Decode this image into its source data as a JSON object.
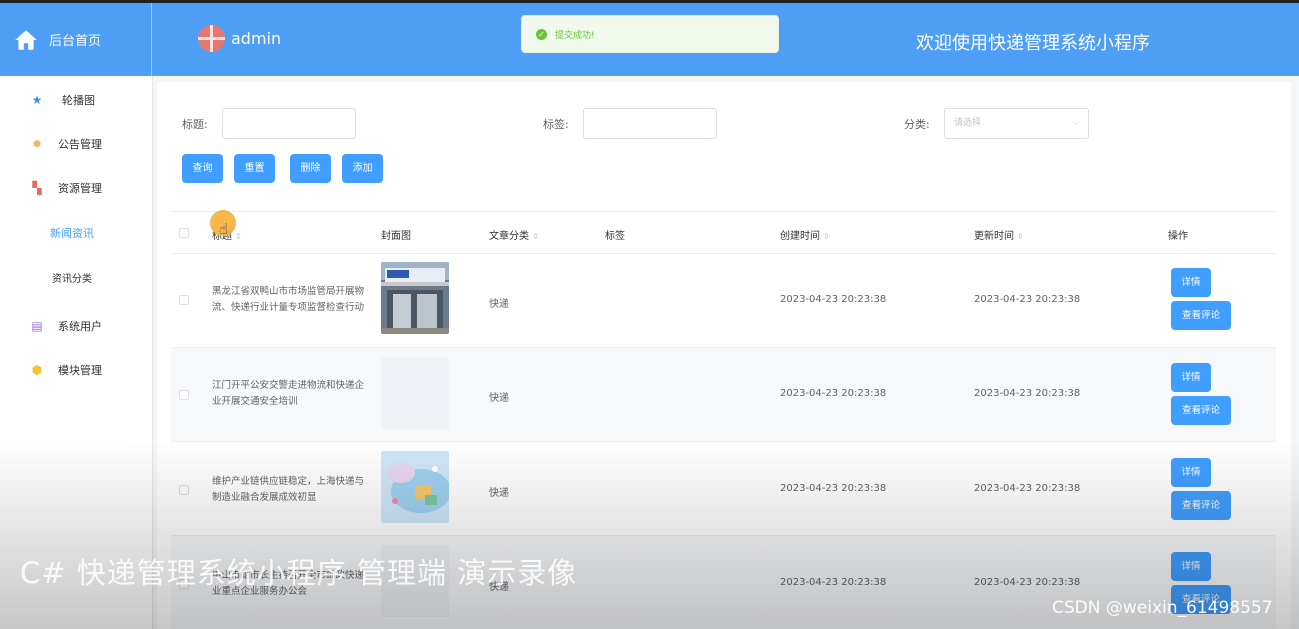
{
  "header": {
    "brand": "后台首页",
    "user": "admin",
    "welcome": "欢迎使用快递管理系统小程序",
    "toast": "提交成功!"
  },
  "sidebar": {
    "items": [
      {
        "label": "轮播图",
        "icon": "star-icon",
        "color": "#3a8ee6"
      },
      {
        "label": "公告管理",
        "icon": "gear-icon",
        "color": "#f0b35a"
      },
      {
        "label": "资源管理",
        "icon": "grid-icon",
        "color": "#e86a5c"
      },
      {
        "label": "新闻资讯",
        "active": true
      },
      {
        "label": "资讯分类"
      },
      {
        "label": "系统用户",
        "icon": "archive-icon",
        "color": "#9a6ed0"
      },
      {
        "label": "模块管理",
        "icon": "cube-icon",
        "color": "#f2c230"
      }
    ]
  },
  "filters": {
    "title_label": "标题:",
    "tag_label": "标签:",
    "category_label": "分类:",
    "category_placeholder": "请选择"
  },
  "actions": {
    "query": "查询",
    "reset": "重置",
    "delete": "删除",
    "add": "添加"
  },
  "table": {
    "columns": {
      "title": "标题",
      "cover": "封面图",
      "category": "文章分类",
      "tags": "标签",
      "created": "创建时间",
      "updated": "更新时间",
      "ops": "操作"
    },
    "rows": [
      {
        "title": "黑龙江省双鸭山市市场监管局开展物流、快递行业计量专项监督检查行动",
        "category": "快递",
        "created": "2023-04-23 20:23:38",
        "updated": "2023-04-23 20:23:38",
        "detail": "详情",
        "comments": "查看评论"
      },
      {
        "title": "江门开平公安交警走进物流和快递企业开展交通安全培训",
        "category": "快递",
        "created": "2023-04-23 20:23:38",
        "updated": "2023-04-23 20:23:38",
        "detail": "详情",
        "comments": "查看评论"
      },
      {
        "title": "维护产业链供应链稳定，上海快递与制造业融合发展成效初显",
        "category": "快递",
        "created": "2023-04-23 20:23:38",
        "updated": "2023-04-23 20:23:38",
        "detail": "详情",
        "comments": "查看评论"
      },
      {
        "title": "中山市副市长主持召开全市邮政快递业重点企业服务办公会",
        "category": "快递",
        "created": "2023-04-23 20:23:38",
        "updated": "2023-04-23 20:23:38",
        "detail": "详情",
        "comments": "查看评论"
      }
    ]
  },
  "overlay": {
    "caption": "C# 快递管理系统小程序 管理端 演示录像",
    "watermark": "CSDN @weixin_61498557"
  },
  "colors": {
    "header": "#4f9ef5",
    "primary": "#409eff",
    "success": "#67c23a"
  }
}
